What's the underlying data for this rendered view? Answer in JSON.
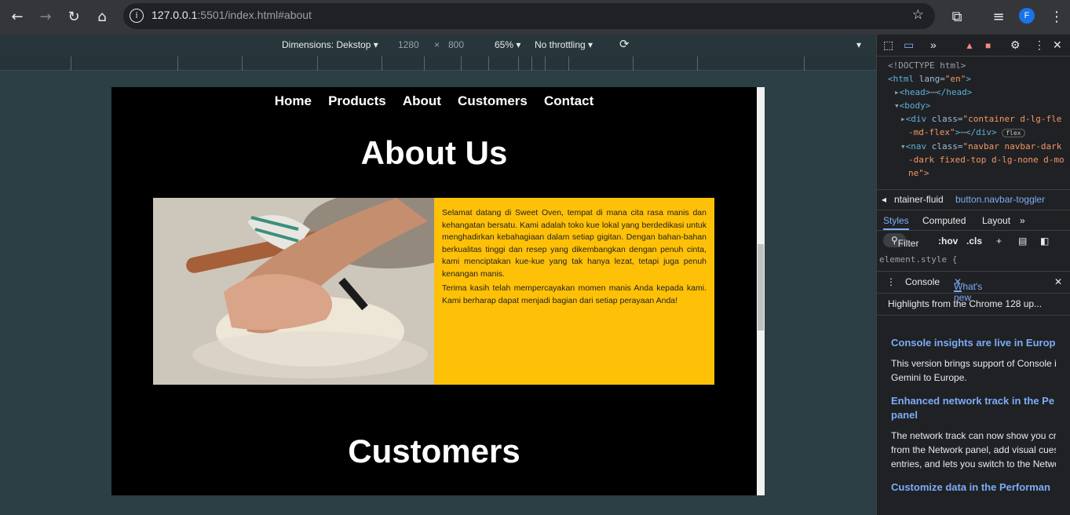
{
  "browser": {
    "url_host": "127.0.0.1",
    "url_rest": ":5501/index.html#about",
    "profile_initial": "F"
  },
  "device_toolbar": {
    "dimensions_label": "Dimensions: Dekstop",
    "width": "1280",
    "times": "×",
    "height": "800",
    "zoom": "65%",
    "throttling": "No throttling"
  },
  "site": {
    "nav": [
      "Home",
      "Products",
      "About",
      "Customers",
      "Contact"
    ],
    "about_title": "About Us",
    "about_paragraphs": [
      "Selamat datang di Sweet Oven, tempat di mana cita rasa manis dan kehangatan bersatu. Kami adalah toko kue lokal yang berdedikasi untuk menghadirkan kebahagiaan dalam setiap gigitan. Dengan bahan-bahan berkualitas tinggi dan resep yang dikembangkan dengan penuh cinta, kami menciptakan kue-kue yang tak hanya lezat, tetapi juga penuh kenangan manis.",
      "Terima kasih telah mempercayakan momen manis Anda kepada kami. Kami berharap dapat menjadi bagian dari setiap perayaan Anda!"
    ],
    "customers_title": "Customers"
  },
  "devtools": {
    "dom": {
      "doctype": "<!DOCTYPE html>",
      "html_tag": "<html ",
      "html_attr": "lang=",
      "html_val": "\"en\"",
      "head": "<head>",
      "head_close": "</head>",
      "body": "<body>",
      "div_open": "<div ",
      "div_attr": "class=",
      "div_val": "\"container d-lg-fle",
      "div_val2": "-md-flex\"",
      "div_close": "</div>",
      "flex_badge": "flex",
      "nav_open": "<nav ",
      "nav_attr": "class=",
      "nav_val": "\"navbar navbar-dark",
      "nav_val2": "-dark fixed-top d-lg-none d-mo",
      "nav_val3": "ne\">"
    },
    "breadcrumbs": [
      "ntainer-fluid",
      "button.navbar-toggler"
    ],
    "styles_tabs": [
      "Styles",
      "Computed",
      "Layout"
    ],
    "filter": "Filter",
    "hov": ":hov",
    "cls": ".cls",
    "element_style": "element.style {",
    "drawer_tabs": [
      "Console",
      "What's new"
    ],
    "drawer_subtitle": "Highlights from the Chrome 128 up...",
    "whats_new": [
      {
        "heading": "Console insights are live in Europ",
        "body": [
          "This version brings support of Console in",
          "Gemini to Europe."
        ]
      },
      {
        "heading": "Enhanced network track in the Pe",
        "heading2": "panel",
        "body": [
          "The network track can now show you crit",
          "from the Network panel, add visual cues",
          "entries, and lets you switch to the Netwo"
        ]
      },
      {
        "heading": "Customize data in the Performan",
        "body": []
      }
    ]
  }
}
